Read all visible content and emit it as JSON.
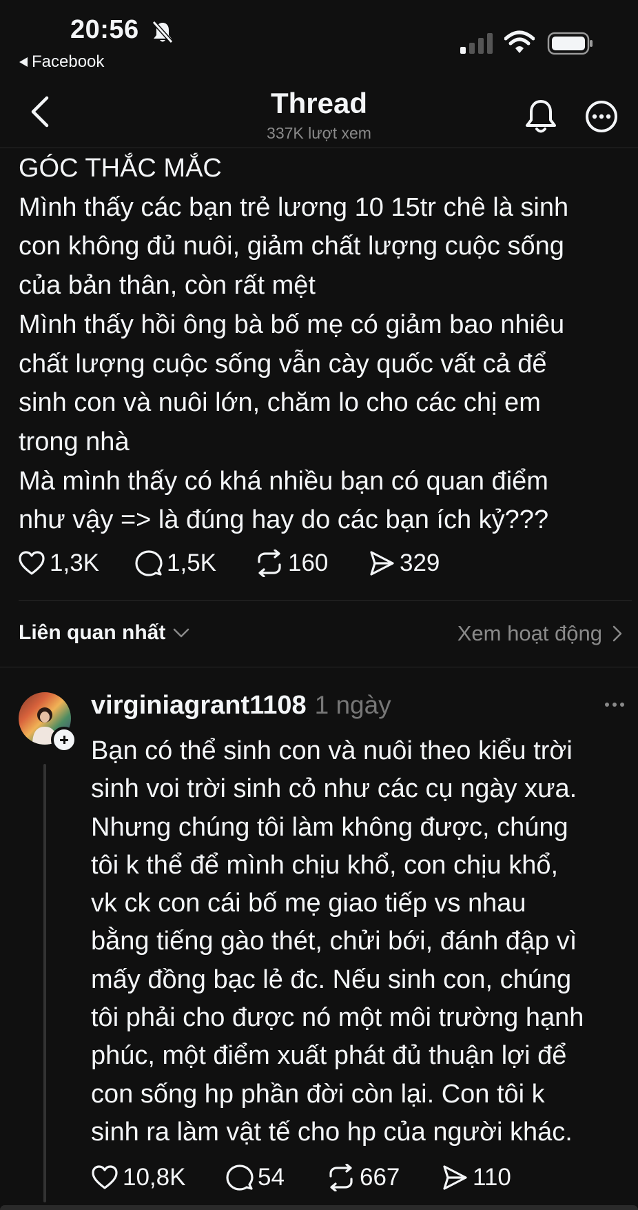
{
  "status_bar": {
    "time": "20:56",
    "back_app_label": "Facebook",
    "icons": [
      "bell-off-icon",
      "signal-icon",
      "wifi-icon",
      "battery-icon"
    ]
  },
  "header": {
    "title": "Thread",
    "views": "337K lượt xem",
    "icons": [
      "back-chevron-icon",
      "bell-icon",
      "more-icon"
    ]
  },
  "post": {
    "lines": [
      "GÓC THẮC MẮC",
      "Mình thấy các bạn trẻ lương 10 15tr chê là sinh",
      "con không đủ nuôi, giảm chất lượng cuộc sống",
      "của bản thân, còn rất mệt",
      "Mình thấy hồi ông bà bố mẹ có giảm bao nhiêu",
      "chất lượng cuộc sống vẫn cày quốc vất cả để",
      "sinh con và nuôi lớn, chăm lo cho các chị em",
      "trong nhà",
      "Mà mình thấy có khá nhiều bạn có quan điểm",
      "như vậy => là đúng hay do các bạn ích kỷ???"
    ],
    "likes": "1,3K",
    "comments": "1,5K",
    "reposts": "160",
    "shares": "329"
  },
  "sort": {
    "label": "Liên quan nhất",
    "activity_link": "Xem hoạt động"
  },
  "reply": {
    "username": "virginiagrant1108",
    "time": "1 ngày",
    "lines": [
      "Bạn có thể sinh con và nuôi theo kiểu trời",
      "sinh voi trời sinh cỏ như các cụ ngày xưa.",
      "Nhưng chúng tôi làm không được, chúng",
      "tôi k thể để mình chịu khổ, con chịu khổ,",
      "vk ck con cái bố mẹ giao tiếp vs nhau",
      "bằng tiếng gào thét, chửi bới, đánh đập vì",
      "mấy đồng bạc lẻ đc. Nếu sinh con, chúng",
      "tôi phải cho được nó một môi trường hạnh",
      "phúc, một điểm xuất phát đủ thuận lợi để",
      "con sống hp phần đời còn lại. Con tôi k",
      "sinh ra làm vật tế cho hp của người khác."
    ],
    "likes": "10,8K",
    "comments": "54",
    "reposts": "667",
    "shares": "110"
  },
  "colors": {
    "background": "#101010",
    "text": "#f3f5f7",
    "muted": "#8a8a8a",
    "divider": "#2a2a2a"
  }
}
